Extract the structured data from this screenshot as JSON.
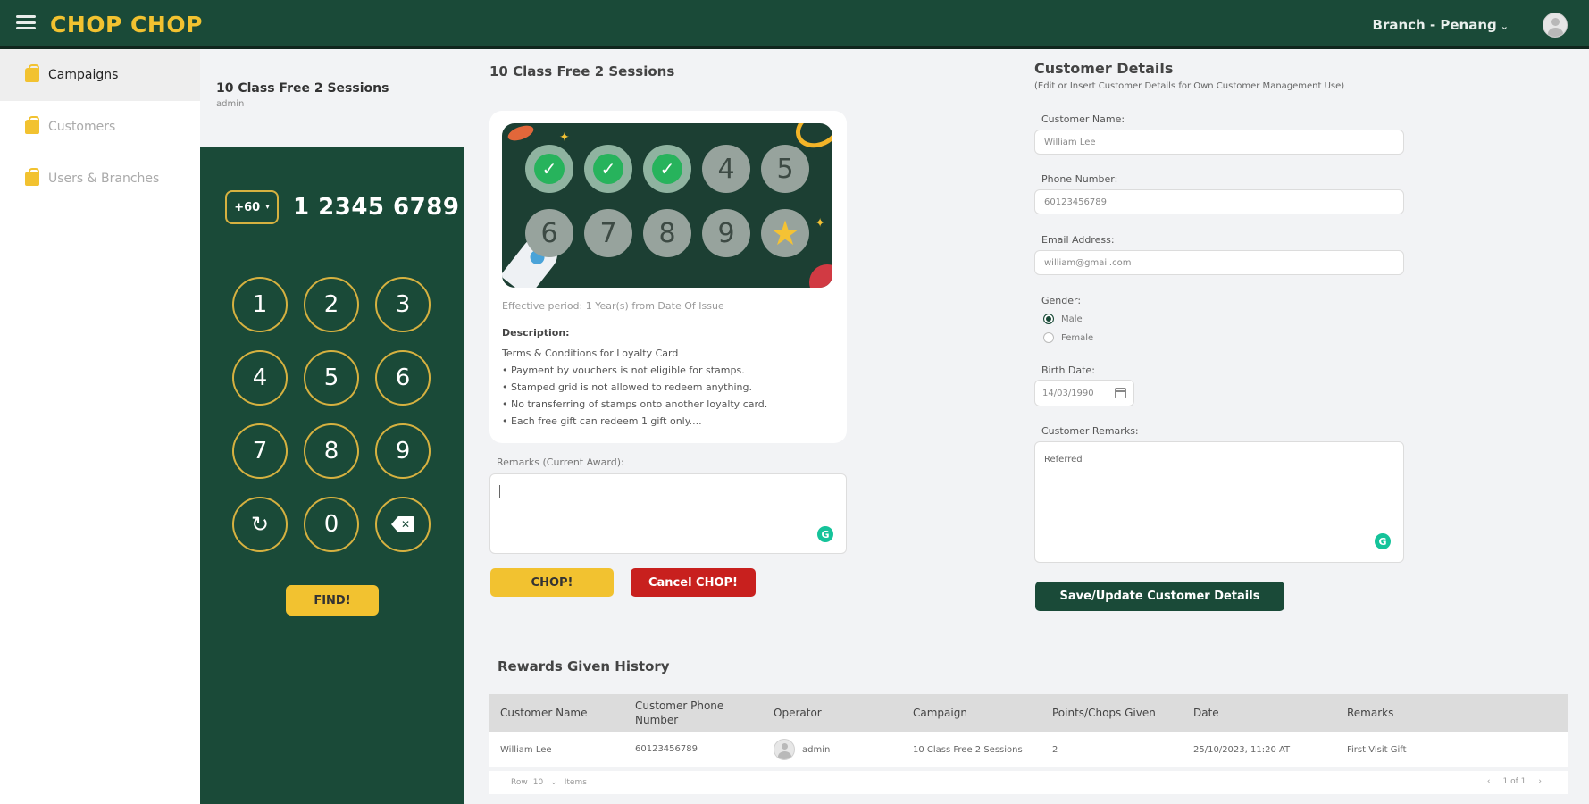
{
  "header": {
    "logo": "CHOP CHOP",
    "branch_label": "Branch - Penang",
    "chevron": "⌄"
  },
  "sidebar": {
    "items": [
      {
        "label": "Campaigns",
        "icon": "store-icon"
      },
      {
        "label": "Customers",
        "icon": "store-icon"
      },
      {
        "label": "Users & Branches",
        "icon": "store-icon"
      }
    ]
  },
  "campaign_panel": {
    "title": "10 Class Free 2 Sessions",
    "user": "admin"
  },
  "keypad": {
    "country_code": "+60",
    "phone_number": "1 2345 6789",
    "keys": [
      "1",
      "2",
      "3",
      "4",
      "5",
      "6",
      "7",
      "8",
      "9",
      "↻",
      "0",
      "✕"
    ],
    "find_label": "FIND!"
  },
  "campaign_detail": {
    "title": "10 Class Free 2 Sessions",
    "stamps": [
      "✓",
      "✓",
      "✓",
      "4",
      "5",
      "6",
      "7",
      "8",
      "9",
      "★"
    ],
    "effective": "Effective period: 1 Year(s) from Date Of Issue",
    "description_label": "Description:",
    "description_lines": [
      "Terms & Conditions for Loyalty Card",
      "• Payment by vouchers is not eligible for stamps.",
      "• Stamped grid is not allowed to redeem anything.",
      "• No transferring of stamps onto another loyalty card.",
      "• Each free gift can redeem 1 gift only...."
    ],
    "remarks_label": "Remarks (Current Award):",
    "chop_label": "CHOP!",
    "cancel_label": "Cancel CHOP!"
  },
  "customer": {
    "title": "Customer Details",
    "subtitle": "(Edit or Insert Customer Details for Own Customer Management Use)",
    "name_label": "Customer Name:",
    "name_value": "William Lee",
    "phone_label": "Phone Number:",
    "phone_value": "60123456789",
    "email_label": "Email Address:",
    "email_value": "william@gmail.com",
    "gender_label": "Gender:",
    "gender_options": [
      "Male",
      "Female"
    ],
    "birth_label": "Birth Date:",
    "birth_value": "14/03/1990",
    "remarks_label": "Customer Remarks:",
    "remarks_value": "Referred",
    "save_label": "Save/Update Customer Details"
  },
  "history": {
    "title": "Rewards Given History",
    "columns": [
      "Customer Name",
      "Customer Phone Number",
      "Operator",
      "Campaign",
      "Points/Chops Given",
      "Date",
      "Remarks"
    ],
    "rows": [
      [
        "William Lee",
        "60123456789",
        "admin",
        "10 Class Free 2 Sessions",
        "2",
        "25/10/2023, 11:20 AT",
        "First Visit Gift"
      ]
    ],
    "footer_rows": "Row",
    "footer_count": "10",
    "footer_items": "Items",
    "pager_prev": "‹",
    "pager_text": "1 of 1",
    "pager_next": "›"
  }
}
